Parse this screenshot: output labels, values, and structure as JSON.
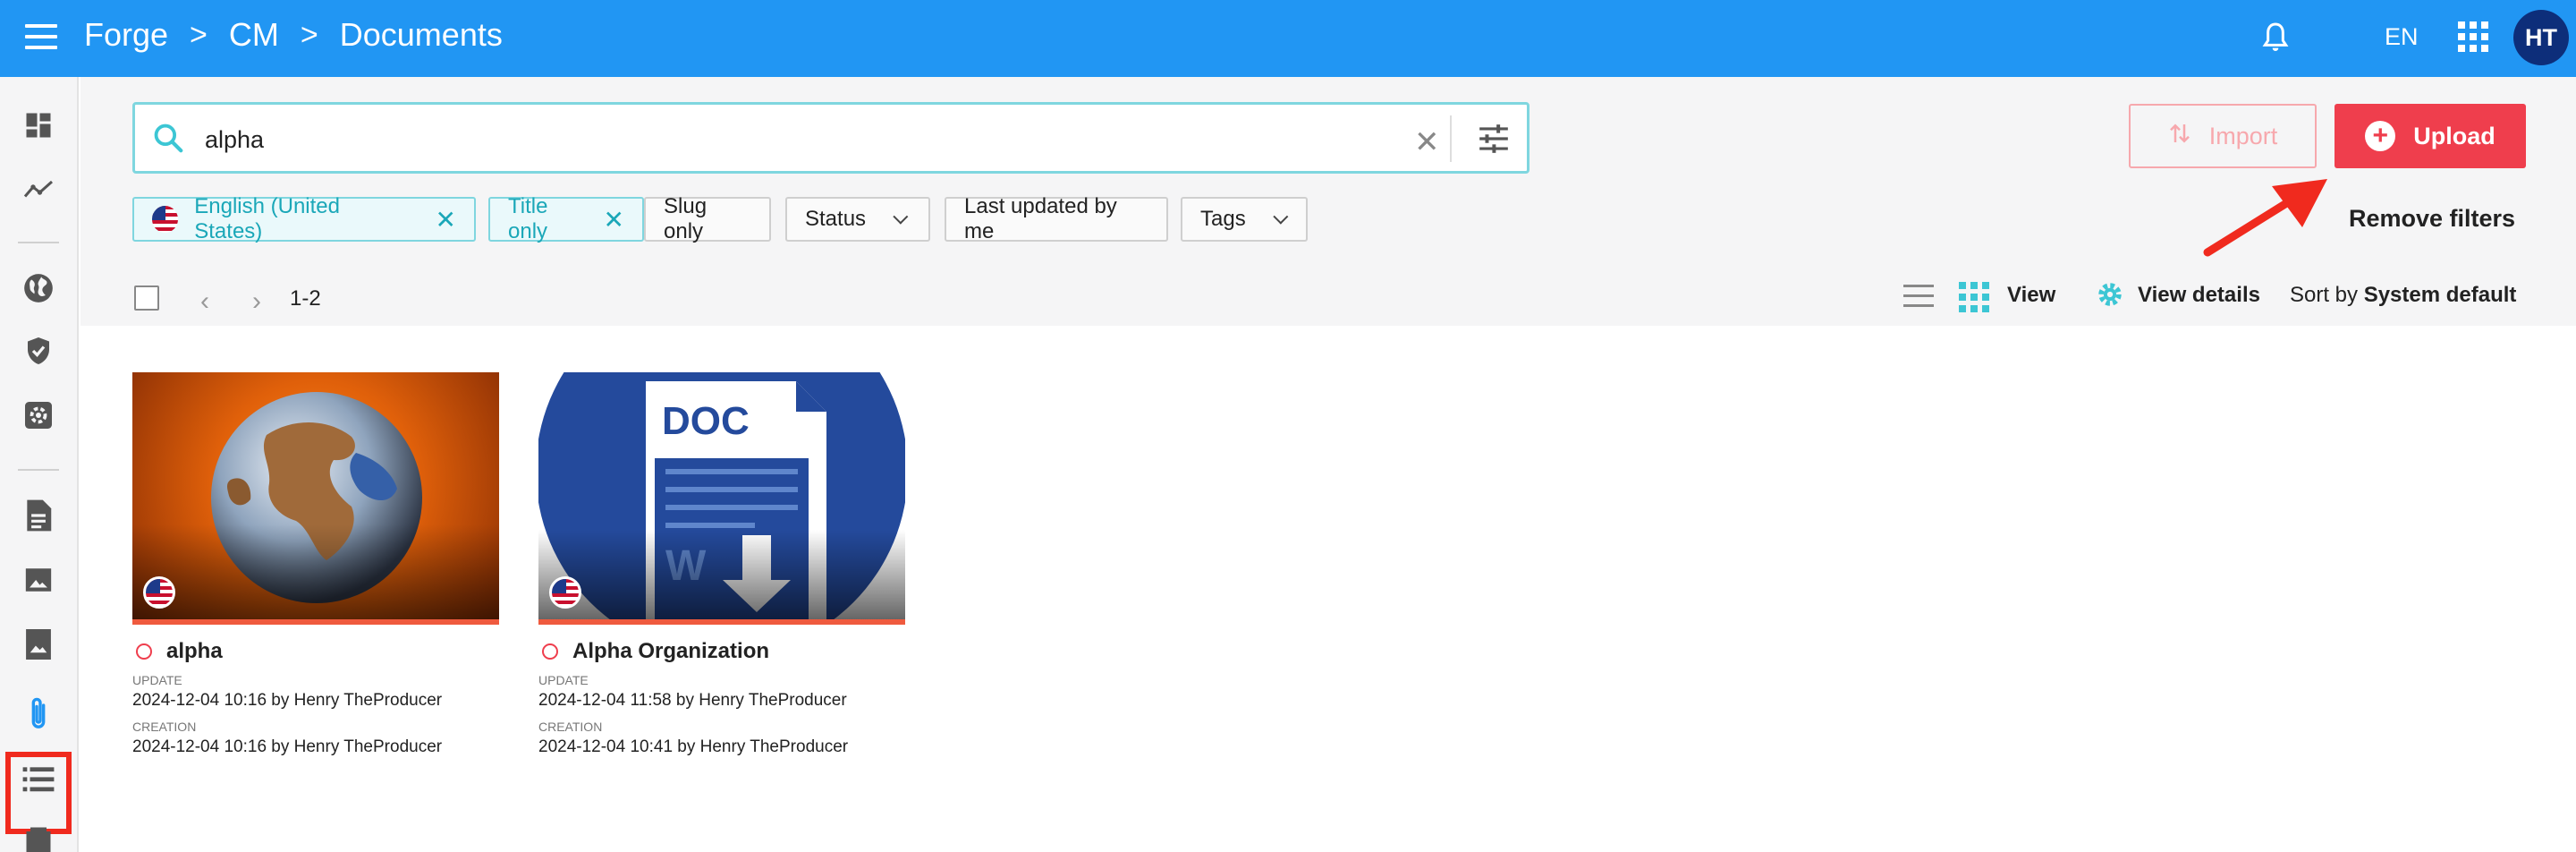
{
  "header": {
    "breadcrumbs": [
      "Forge",
      "CM",
      "Documents"
    ],
    "separator": ">",
    "language": "EN",
    "avatar_initials": "HT",
    "bar_color": "#2196f3"
  },
  "sidebar": {
    "items": [
      {
        "icon": "dashboard-icon"
      },
      {
        "icon": "analytics-icon"
      },
      {
        "icon": "globe-icon"
      },
      {
        "icon": "shield-check-icon"
      },
      {
        "icon": "settings-cog-icon"
      },
      {
        "icon": "document-icon"
      },
      {
        "icon": "image-icon"
      },
      {
        "icon": "bookmark-image-icon"
      },
      {
        "icon": "attachment-icon",
        "active": true
      },
      {
        "icon": "list-icon"
      },
      {
        "icon": "layers-icon"
      }
    ]
  },
  "search": {
    "value": "alpha",
    "clear_symbol": "✕"
  },
  "actions": {
    "import_label": "Import",
    "upload_label": "Upload",
    "upload_color": "#ef3e4d"
  },
  "filters": {
    "chips": [
      {
        "label": "English (United States)",
        "active": true,
        "removable": true
      },
      {
        "label": "Title only",
        "active": true,
        "removable": true
      },
      {
        "label": "Slug only",
        "active": false
      },
      {
        "label": "Status",
        "active": false,
        "dropdown": true
      },
      {
        "label": "Last updated by me",
        "active": false
      },
      {
        "label": "Tags",
        "active": false,
        "dropdown": true
      }
    ],
    "remove_label": "Remove filters"
  },
  "toolbar": {
    "range": "1-2",
    "view_label": "View",
    "view_details_label": "View details",
    "sort_prefix": "Sort by",
    "sort_value": "System default"
  },
  "documents": [
    {
      "title": "alpha",
      "update_label": "UPDATE",
      "update_value": "2024-12-04 10:16 by Henry TheProducer",
      "creation_label": "CREATION",
      "creation_value": "2024-12-04 10:16 by Henry TheProducer"
    },
    {
      "title": "Alpha Organization",
      "update_label": "UPDATE",
      "update_value": "2024-12-04 11:58 by Henry TheProducer",
      "creation_label": "CREATION",
      "creation_value": "2024-12-04 10:41 by Henry TheProducer",
      "thumb_text": "DOC"
    }
  ]
}
